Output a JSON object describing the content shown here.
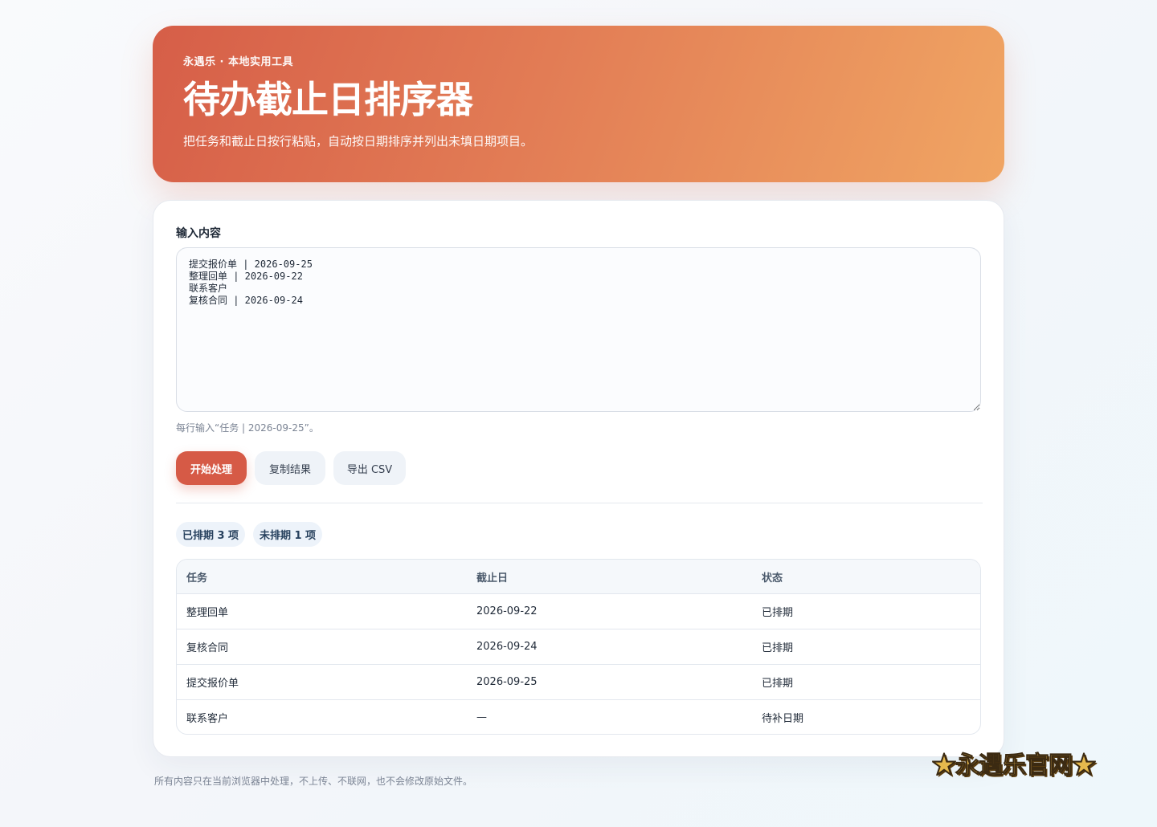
{
  "hero": {
    "kicker": "永遇乐 · 本地实用工具",
    "title": "待办截止日排序器",
    "subtitle": "把任务和截止日按行粘贴，自动按日期排序并列出未填日期项目。"
  },
  "form": {
    "label": "输入内容",
    "textarea_value": "提交报价单 | 2026-09-25\n整理回单 | 2026-09-22\n联系客户\n复核合同 | 2026-09-24",
    "hint": "每行输入“任务 | 2026-09-25”。"
  },
  "actions": {
    "start": "开始处理",
    "copy": "复制结果",
    "export": "导出 CSV"
  },
  "summary": {
    "scheduled": "已排期 3 项",
    "unscheduled": "未排期 1 项"
  },
  "table": {
    "headers": [
      "任务",
      "截止日",
      "状态"
    ],
    "rows": [
      [
        "整理回单",
        "2026-09-22",
        "已排期"
      ],
      [
        "复核合同",
        "2026-09-24",
        "已排期"
      ],
      [
        "提交报价单",
        "2026-09-25",
        "已排期"
      ],
      [
        "联系客户",
        "—",
        "待补日期"
      ]
    ]
  },
  "footer": {
    "note": "所有内容只在当前浏览器中处理，不上传、不联网，也不会修改原始文件。"
  },
  "watermark": "★永遇乐官网★",
  "colors": {
    "hero_start": "#d65e48",
    "hero_end": "#f0a563",
    "primary_button": "#d65a46",
    "badge_bg": "#edf3fa"
  }
}
